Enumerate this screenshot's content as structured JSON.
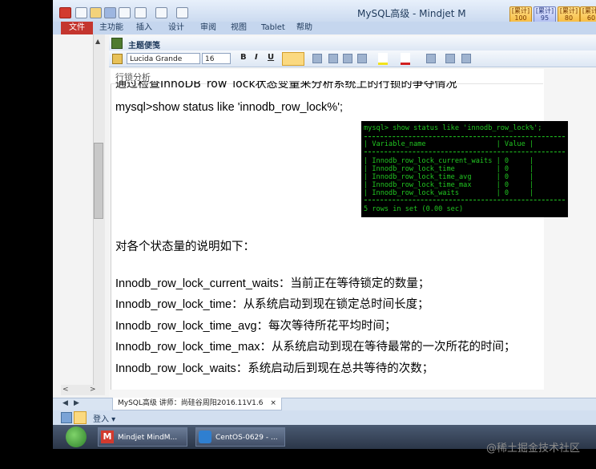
{
  "window": {
    "title": "MySQL高级 - Mindjet M",
    "badges": [
      {
        "top": "[累计]",
        "value": "100",
        "color": "#f5b536"
      },
      {
        "top": "[累计]",
        "value": "95",
        "color": "#aab8ef"
      },
      {
        "top": "[累计]",
        "value": "80",
        "color": "#f5b536"
      },
      {
        "top": "[累计]",
        "value": "60",
        "color": "#f5b536"
      }
    ]
  },
  "menu": {
    "file": "文件",
    "items": [
      "主功能",
      "插入",
      "设计",
      "审阅",
      "视图",
      "Tablet",
      "帮助"
    ]
  },
  "toolbar": {
    "topic_notes": "主题便笺",
    "font": "Lucida Grande",
    "size": "16",
    "bold": "B",
    "italic": "I",
    "underline": "U"
  },
  "page": {
    "header": "行锁分析",
    "cut_line": "通过检查InnoDB_row_lock状态变量来分析系统上的行锁的争夺情况",
    "command": "mysql>show status like 'innodb_row_lock%';",
    "explain_title": "对各个状态量的说明如下：",
    "items": [
      {
        "name": "Innodb_row_lock_current_waits",
        "desc": "：当前正在等待锁定的数量；"
      },
      {
        "name": "Innodb_row_lock_time",
        "desc": "：从系统启动到现在锁定总时间长度；"
      },
      {
        "name": "Innodb_row_lock_time_avg",
        "desc": "：每次等待所花平均时间；"
      },
      {
        "name": "Innodb_row_lock_time_max",
        "desc": "：从系统启动到现在等待最常的一次所花的时间；"
      },
      {
        "name": "Innodb_row_lock_waits",
        "desc": "：系统启动后到现在总共等待的次数；"
      }
    ]
  },
  "terminal": {
    "prompt": "mysql> show status like 'innodb_row_lock%';",
    "header": "| Variable_name                 | Value |",
    "rows": [
      "| Innodb_row_lock_current_waits | 0     |",
      "| Innodb_row_lock_time          | 0     |",
      "| Innodb_row_lock_time_avg      | 0     |",
      "| Innodb_row_lock_time_max      | 0     |",
      "| Innodb_row_lock_waits         | 0     |"
    ],
    "footer": "5 rows in set (0.00 sec)"
  },
  "tabs": {
    "active": "MySQL高级 讲师：尚硅谷周阳2016.11V1.6"
  },
  "status": {
    "login": "登入 ▾"
  },
  "taskbar": {
    "tasks": [
      "Mindjet MindM...",
      "CentOS-0629 - ..."
    ]
  },
  "watermark": "@稀土掘金技术社区"
}
